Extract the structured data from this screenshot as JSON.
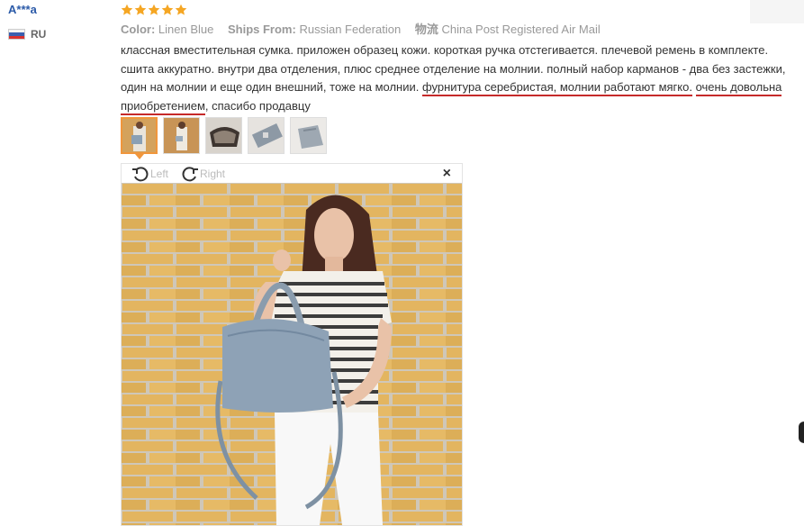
{
  "buyer": {
    "name": "A***a",
    "country": "RU"
  },
  "review": {
    "rating": 5,
    "meta": {
      "color_key": "Color:",
      "color_val": "Linen Blue",
      "ships_key": "Ships From:",
      "ships_val": "Russian Federation",
      "shipping_key": "物流",
      "shipping_val": "China Post Registered Air Mail"
    },
    "text_part1": "классная вместительная сумка. приложен образец кожи. короткая ручка отстегивается. плечевой ремень в комплекте. сшита аккуратно. внутри два отделения, плюс среднее отделение на молнии. полный набор карманов - два без застежки, один на молнии и еще один внешний, тоже на молнии. ",
    "text_underlined1": "фурнитура серебристая, молнии работают мягко.",
    "text_space": " ",
    "text_underlined2": "очень довольна приобретением",
    "text_part2": ", спасибо продавцу"
  },
  "thumbnails": [
    {
      "label": "photo-1",
      "selected": true
    },
    {
      "label": "photo-2",
      "selected": false
    },
    {
      "label": "photo-3",
      "selected": false
    },
    {
      "label": "photo-4",
      "selected": false
    },
    {
      "label": "photo-5",
      "selected": false
    }
  ],
  "viewer": {
    "rotate_left": "Left",
    "rotate_right": "Right",
    "close": "×"
  },
  "colors": {
    "accent": "#f0963c",
    "star": "#f5a623",
    "underline": "#c62a2a",
    "link": "#2b5aa8"
  }
}
